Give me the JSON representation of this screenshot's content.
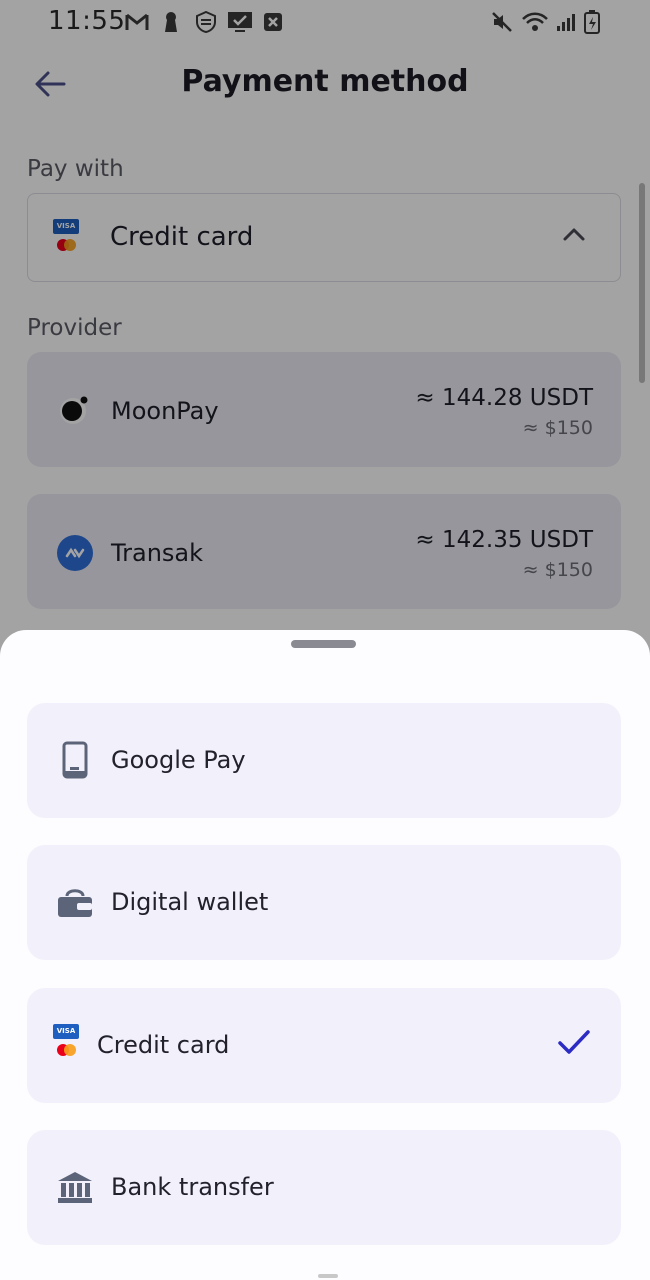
{
  "status_bar": {
    "time": "11:55"
  },
  "header": {
    "title": "Payment method"
  },
  "pay_with": {
    "label": "Pay with",
    "selected": "Credit card"
  },
  "provider": {
    "label": "Provider",
    "items": [
      {
        "name": "MoonPay",
        "amount": "≈ 144.28 USDT",
        "fiat": "≈ $150",
        "icon": "moonpay-icon"
      },
      {
        "name": "Transak",
        "amount": "≈ 142.35 USDT",
        "fiat": "≈ $150",
        "icon": "transak-icon"
      }
    ]
  },
  "sheet": {
    "options": [
      {
        "label": "Google Pay",
        "icon": "phone-icon",
        "selected": false
      },
      {
        "label": "Digital wallet",
        "icon": "wallet-icon",
        "selected": false
      },
      {
        "label": "Credit card",
        "icon": "credit-card-icon",
        "selected": true
      },
      {
        "label": "Bank transfer",
        "icon": "bank-icon",
        "selected": false
      }
    ]
  },
  "colors": {
    "accent": "#2c2cc4",
    "card_bg": "#ecebf5",
    "option_bg": "#f2f0fa",
    "visa_blue": "#1f5fbf",
    "transak_blue": "#2f6fd9"
  }
}
